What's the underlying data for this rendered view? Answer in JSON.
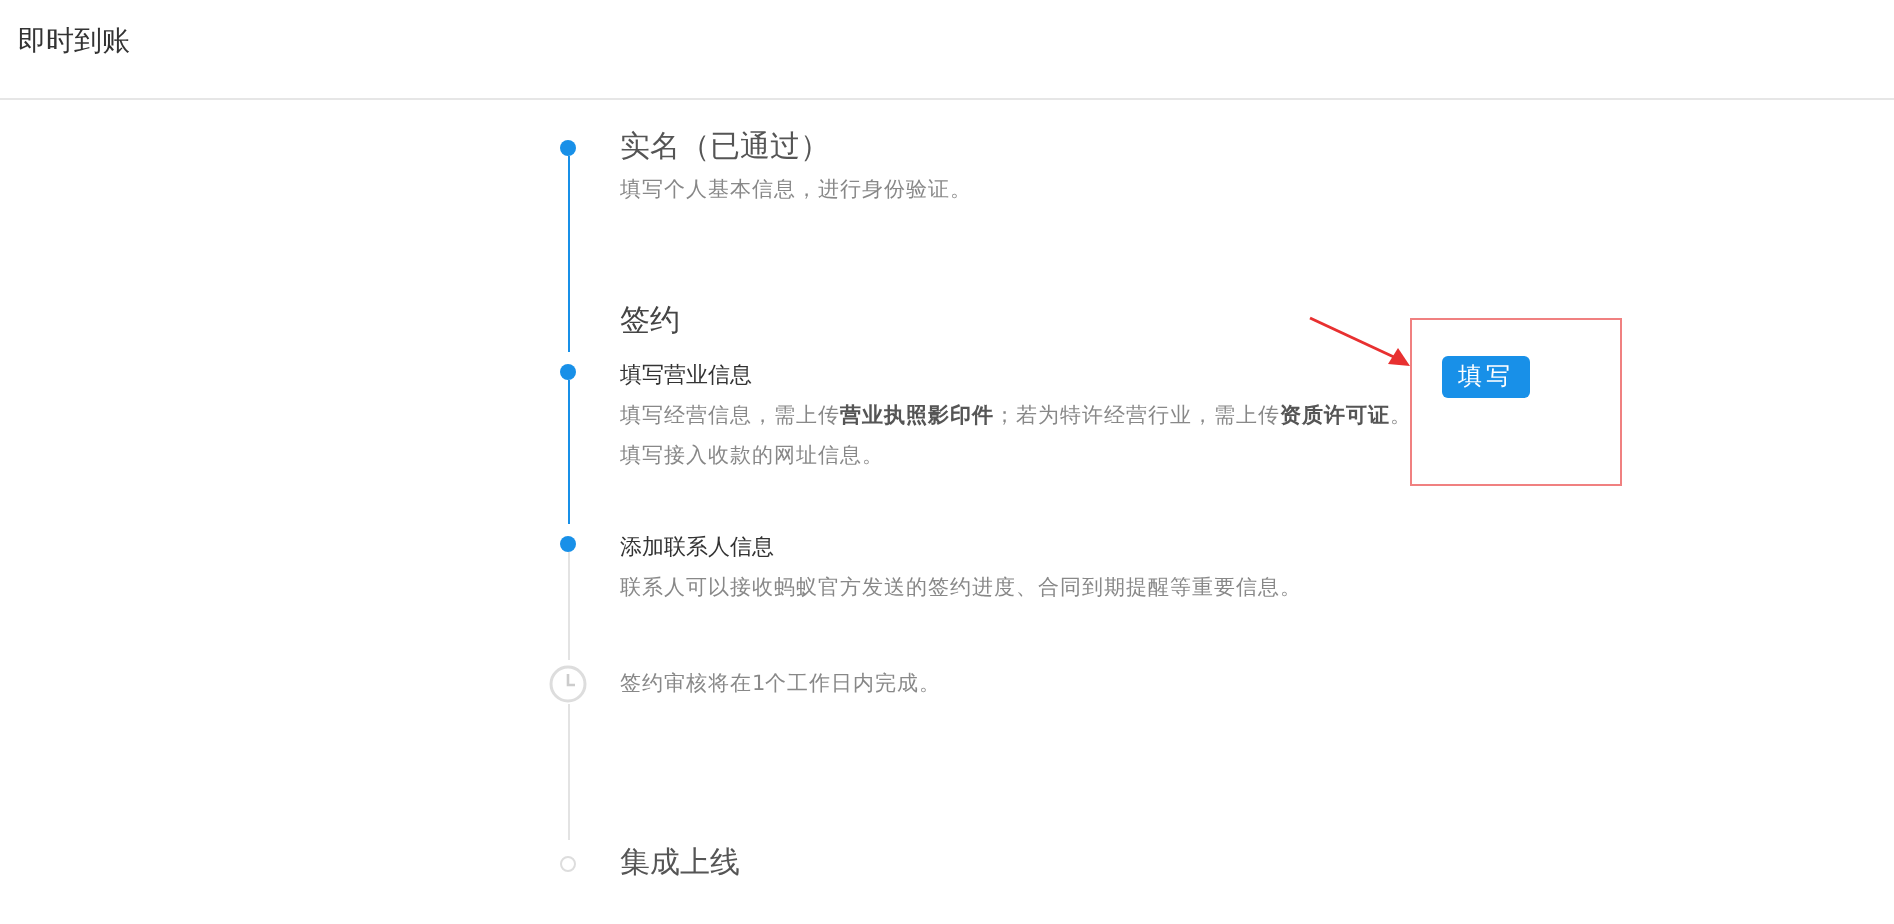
{
  "header": {
    "title": "即时到账"
  },
  "steps": [
    {
      "kind": "milestone",
      "completed": true,
      "title": "实名（已通过）",
      "description": [
        "填写个人基本信息，进行身份验证。"
      ]
    },
    {
      "kind": "section",
      "title": "签约"
    },
    {
      "kind": "task",
      "completed": true,
      "title": "填写营业信息",
      "description": [
        "填写经营信息，需上传**营业执照影印件**；若为特许经营行业，需上传**资质许可证**。",
        "填写接入收款的网址信息。"
      ],
      "action": "填写"
    },
    {
      "kind": "task",
      "completed": true,
      "title": "添加联系人信息",
      "description": [
        "联系人可以接收蚂蚁官方发送的签约进度、合同到期提醒等重要信息。"
      ]
    },
    {
      "kind": "notice",
      "completed": false,
      "title": "签约审核将在1个工作日内完成。"
    },
    {
      "kind": "milestone",
      "completed": false,
      "title": "集成上线"
    }
  ]
}
